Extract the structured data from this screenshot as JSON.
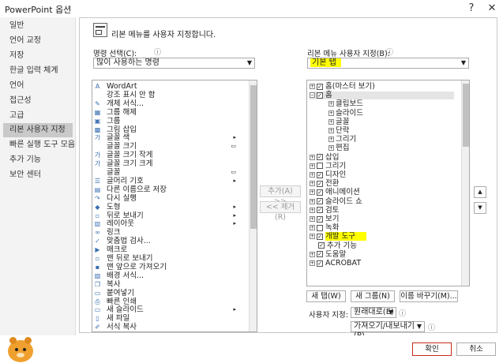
{
  "window": {
    "title": "PowerPoint 옵션",
    "help": "?",
    "close": "✕"
  },
  "sidebar": {
    "items": [
      "일반",
      "언어 교정",
      "저장",
      "한글 입력 체계",
      "언어",
      "접근성",
      "고급",
      "리본 사용자 지정",
      "빠른 실행 도구 모음",
      "추가 기능",
      "보안 센터"
    ],
    "selected_index": 7
  },
  "header": {
    "text": "리본 메뉴를 사용자 지정합니다."
  },
  "left": {
    "label": "명령 선택(C):",
    "info": "ⓘ",
    "dropdown_value": "많이 사용하는 명령",
    "commands": [
      {
        "icon": "wordart-icon",
        "glyph": "A",
        "label": "WordArt",
        "sub": ""
      },
      {
        "icon": "emphasis-icon",
        "glyph": "",
        "label": "강조 표시 안 함",
        "sub": ""
      },
      {
        "icon": "format-object-icon",
        "glyph": "✎",
        "label": "개체 서식...",
        "sub": ""
      },
      {
        "icon": "ungroup-icon",
        "glyph": "▦",
        "label": "그룹 해제",
        "sub": ""
      },
      {
        "icon": "group-icon",
        "glyph": "▣",
        "label": "그룹",
        "sub": ""
      },
      {
        "icon": "insert-picture-icon",
        "glyph": "▩",
        "label": "그림 삽입",
        "sub": ""
      },
      {
        "icon": "font-color-icon",
        "glyph": "가",
        "label": "글꼴 색",
        "sub": "▸"
      },
      {
        "icon": "font-size-icon",
        "glyph": "",
        "label": "글꼴 크기",
        "sub": "▭"
      },
      {
        "icon": "shrink-font-icon",
        "glyph": "가",
        "label": "글꼴 크기 작게",
        "sub": ""
      },
      {
        "icon": "grow-font-icon",
        "glyph": "가",
        "label": "글꼴 크기 크게",
        "sub": ""
      },
      {
        "icon": "font-icon",
        "glyph": "",
        "label": "글꼴",
        "sub": "▭"
      },
      {
        "icon": "bullets-icon",
        "glyph": "☰",
        "label": "글머리 기호",
        "sub": "▸"
      },
      {
        "icon": "save-as-icon",
        "glyph": "▤",
        "label": "다른 이름으로 저장",
        "sub": ""
      },
      {
        "icon": "redo-icon",
        "glyph": "↷",
        "label": "다시 실행",
        "sub": ""
      },
      {
        "icon": "shapes-icon",
        "glyph": "◆",
        "label": "도형",
        "sub": "▸"
      },
      {
        "icon": "send-backward-icon",
        "glyph": "▫",
        "label": "뒤로 보내기",
        "sub": "▸"
      },
      {
        "icon": "layout-icon",
        "glyph": "▥",
        "label": "레이아웃",
        "sub": "▸"
      },
      {
        "icon": "link-icon",
        "glyph": "∞",
        "label": "링크",
        "sub": ""
      },
      {
        "icon": "spelling-icon",
        "glyph": "✓",
        "label": "맞춤법 검사...",
        "sub": ""
      },
      {
        "icon": "macro-icon",
        "glyph": "▶",
        "label": "매크로",
        "sub": ""
      },
      {
        "icon": "send-to-back-icon",
        "glyph": "▫",
        "label": "맨 뒤로 보내기",
        "sub": ""
      },
      {
        "icon": "bring-to-front-icon",
        "glyph": "▪",
        "label": "맨 앞으로 가져오기",
        "sub": ""
      },
      {
        "icon": "format-background-icon",
        "glyph": "▧",
        "label": "배경 서식...",
        "sub": ""
      },
      {
        "icon": "copy-icon",
        "glyph": "❐",
        "label": "복사",
        "sub": ""
      },
      {
        "icon": "paste-icon",
        "glyph": "▭",
        "label": "붙여넣기",
        "sub": ""
      },
      {
        "icon": "quick-print-icon",
        "glyph": "⎙",
        "label": "빠른 인쇄",
        "sub": ""
      },
      {
        "icon": "new-slide-icon",
        "glyph": "▭",
        "label": "새 슬라이드",
        "sub": "▸"
      },
      {
        "icon": "new-file-icon",
        "glyph": "▯",
        "label": "새 파일",
        "sub": ""
      },
      {
        "icon": "format-painter-icon",
        "glyph": "✐",
        "label": "서식 복사",
        "sub": ""
      }
    ]
  },
  "middle": {
    "add_label": "추가(A) >>",
    "remove_label": "<< 제거(R)"
  },
  "right": {
    "label": "리본 메뉴 사용자 지정(B):",
    "info": "ⓘ",
    "dropdown_value": "기본 탭",
    "nodes": [
      {
        "level": 0,
        "expander": "⊞",
        "checked": true,
        "label": "홈(마스터 보기)",
        "highlight": false,
        "selected": false
      },
      {
        "level": 0,
        "expander": "⊟",
        "checked": true,
        "label": "홈",
        "highlight": false,
        "selected": true
      },
      {
        "level": 1,
        "expander": "⊞",
        "checked": null,
        "label": "클립보드",
        "highlight": false,
        "selected": false
      },
      {
        "level": 1,
        "expander": "⊞",
        "checked": null,
        "label": "슬라이드",
        "highlight": false,
        "selected": false
      },
      {
        "level": 1,
        "expander": "⊞",
        "checked": null,
        "label": "글꼴",
        "highlight": false,
        "selected": false
      },
      {
        "level": 1,
        "expander": "⊞",
        "checked": null,
        "label": "단락",
        "highlight": false,
        "selected": false
      },
      {
        "level": 1,
        "expander": "⊞",
        "checked": null,
        "label": "그리기",
        "highlight": false,
        "selected": false
      },
      {
        "level": 1,
        "expander": "⊞",
        "checked": null,
        "label": "편집",
        "highlight": false,
        "selected": false
      },
      {
        "level": 0,
        "expander": "⊞",
        "checked": true,
        "label": "삽입",
        "highlight": false,
        "selected": false
      },
      {
        "level": 0,
        "expander": "⊞",
        "checked": false,
        "label": "그리기",
        "highlight": false,
        "selected": false
      },
      {
        "level": 0,
        "expander": "⊞",
        "checked": true,
        "label": "디자인",
        "highlight": false,
        "selected": false
      },
      {
        "level": 0,
        "expander": "⊞",
        "checked": true,
        "label": "전환",
        "highlight": false,
        "selected": false
      },
      {
        "level": 0,
        "expander": "⊞",
        "checked": true,
        "label": "애니메이션",
        "highlight": false,
        "selected": false
      },
      {
        "level": 0,
        "expander": "⊞",
        "checked": true,
        "label": "슬라이드 쇼",
        "highlight": false,
        "selected": false
      },
      {
        "level": 0,
        "expander": "⊞",
        "checked": true,
        "label": "검토",
        "highlight": false,
        "selected": false
      },
      {
        "level": 0,
        "expander": "⊞",
        "checked": true,
        "label": "보기",
        "highlight": false,
        "selected": false
      },
      {
        "level": 0,
        "expander": "⊞",
        "checked": false,
        "label": "녹화",
        "highlight": false,
        "selected": false
      },
      {
        "level": 0,
        "expander": "⊞",
        "checked": true,
        "label": "개발 도구",
        "highlight": true,
        "selected": false
      },
      {
        "level": 0,
        "expander": "",
        "checked": true,
        "label": "추가 기능",
        "highlight": false,
        "selected": false
      },
      {
        "level": 0,
        "expander": "⊞",
        "checked": true,
        "label": "도움말",
        "highlight": false,
        "selected": false
      },
      {
        "level": 0,
        "expander": "⊞",
        "checked": true,
        "label": "ACROBAT",
        "highlight": false,
        "selected": false
      }
    ],
    "new_tab": "새 탭(W)",
    "new_group": "새 그룹(N)",
    "rename": "이름 바꾸기(M)...",
    "customize_label": "사용자 지정:",
    "reset_value": "원래대로(E)",
    "import_export": "가져오기/내보내기(P)",
    "up": "▲",
    "down": "▼"
  },
  "footer": {
    "ok": "확인",
    "cancel": "취소"
  },
  "colors": {
    "highlight": "#ffff00",
    "ok_border": "#c42b1c",
    "selected_nav": "#c9c9c9"
  }
}
